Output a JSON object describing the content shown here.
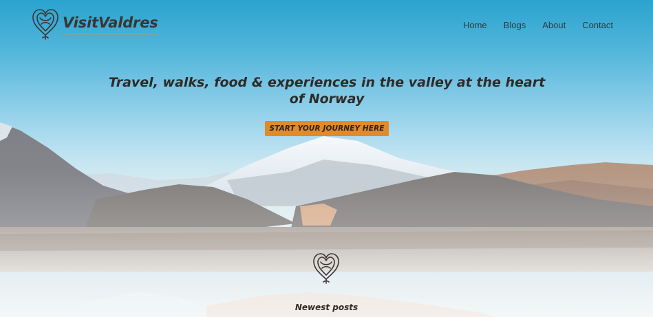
{
  "brand": {
    "name": "VisitValdres",
    "logo_icon": "heart-knot-icon"
  },
  "nav": {
    "items": [
      "Home",
      "Blogs",
      "About",
      "Contact"
    ]
  },
  "hero": {
    "headline": "Travel, walks, food & experiences in the valley at the heart of Norway",
    "cta_label": "Start your journey here"
  },
  "section": {
    "icon": "heart-knot-icon",
    "title": "Newest posts"
  },
  "colors": {
    "accent": "#e08a2a",
    "text_dark": "#2e2a28",
    "sky": "#2aa3cf"
  }
}
